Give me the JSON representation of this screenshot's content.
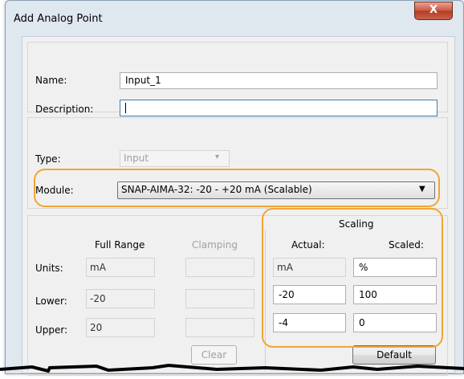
{
  "window": {
    "title": "Add Analog Point",
    "close_glyph": "X"
  },
  "general": {
    "name_label": "Name:",
    "name_value": "Input_1",
    "description_label": "Description:",
    "description_value": ""
  },
  "type": {
    "label": "Type:",
    "value": "Input"
  },
  "module": {
    "label": "Module:",
    "value": "SNAP-AIMA-32: -20 - +20 mA (Scalable)"
  },
  "full_range": {
    "header": "Full Range",
    "units_label": "Units:",
    "units_value": "mA",
    "lower_label": "Lower:",
    "lower_value": "-20",
    "upper_label": "Upper:",
    "upper_value": "20"
  },
  "clamping": {
    "header": "Clamping",
    "clear_label": "Clear"
  },
  "scaling": {
    "header": "Scaling",
    "actual_header": "Actual:",
    "scaled_header": "Scaled:",
    "actual_units": "mA",
    "scaled_units": "%",
    "actual_lower": "-20",
    "scaled_lower": "100",
    "actual_upper": "-4",
    "scaled_upper": "0",
    "default_label": "Default"
  },
  "colors": {
    "highlight": "#f0a534",
    "close_button": "#c75842"
  }
}
